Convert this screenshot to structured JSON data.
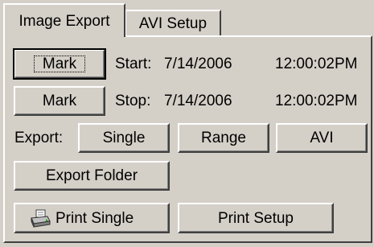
{
  "tabs": [
    {
      "label": "Image Export",
      "active": true
    },
    {
      "label": "AVI Setup",
      "active": false
    }
  ],
  "mark_start": {
    "button_label": "Mark",
    "label": "Start:",
    "date": "7/14/2006",
    "time": "12:00:02PM"
  },
  "mark_stop": {
    "button_label": "Mark",
    "label": "Stop:",
    "date": "7/14/2006",
    "time": "12:00:02PM"
  },
  "export": {
    "label": "Export:",
    "single": "Single",
    "range": "Range",
    "avi": "AVI"
  },
  "export_folder": "Export Folder",
  "print_single": "Print Single",
  "print_setup": "Print Setup",
  "icons": {
    "printer": "printer-icon"
  }
}
